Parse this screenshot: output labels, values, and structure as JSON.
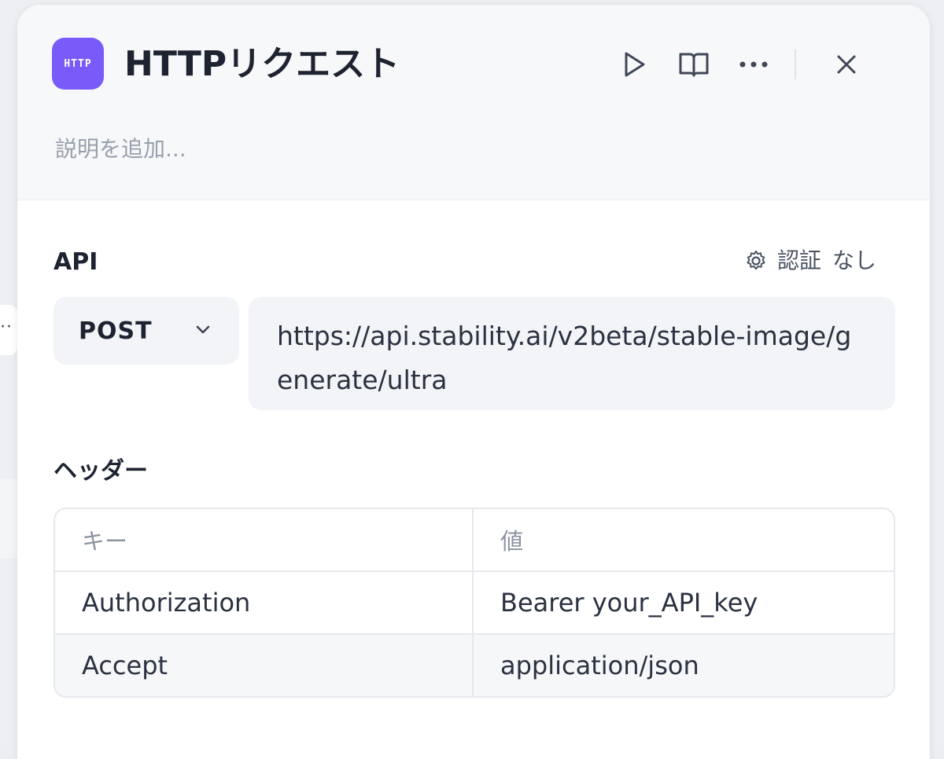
{
  "header": {
    "icon_text": "HTTP",
    "title": "HTTPリクエスト",
    "description_placeholder": "説明を追加..."
  },
  "api": {
    "label": "API",
    "auth_label": "認証",
    "auth_value": "なし",
    "method": "POST",
    "url": "https://api.stability.ai/v2beta/stable-image/generate/ultra"
  },
  "headers": {
    "label": "ヘッダー",
    "columns": [
      "キー",
      "値"
    ],
    "rows": [
      {
        "key": "Authorization",
        "value": "Bearer your_API_key"
      },
      {
        "key": "Accept",
        "value": "application/json"
      }
    ]
  },
  "colors": {
    "icon_bg": "#7a5af8"
  },
  "icons": {
    "run": "play-icon",
    "docs": "book-icon",
    "more": "more-dots-icon",
    "close": "close-icon",
    "auth": "gear-icon",
    "method_dropdown": "chevron-down-icon"
  }
}
